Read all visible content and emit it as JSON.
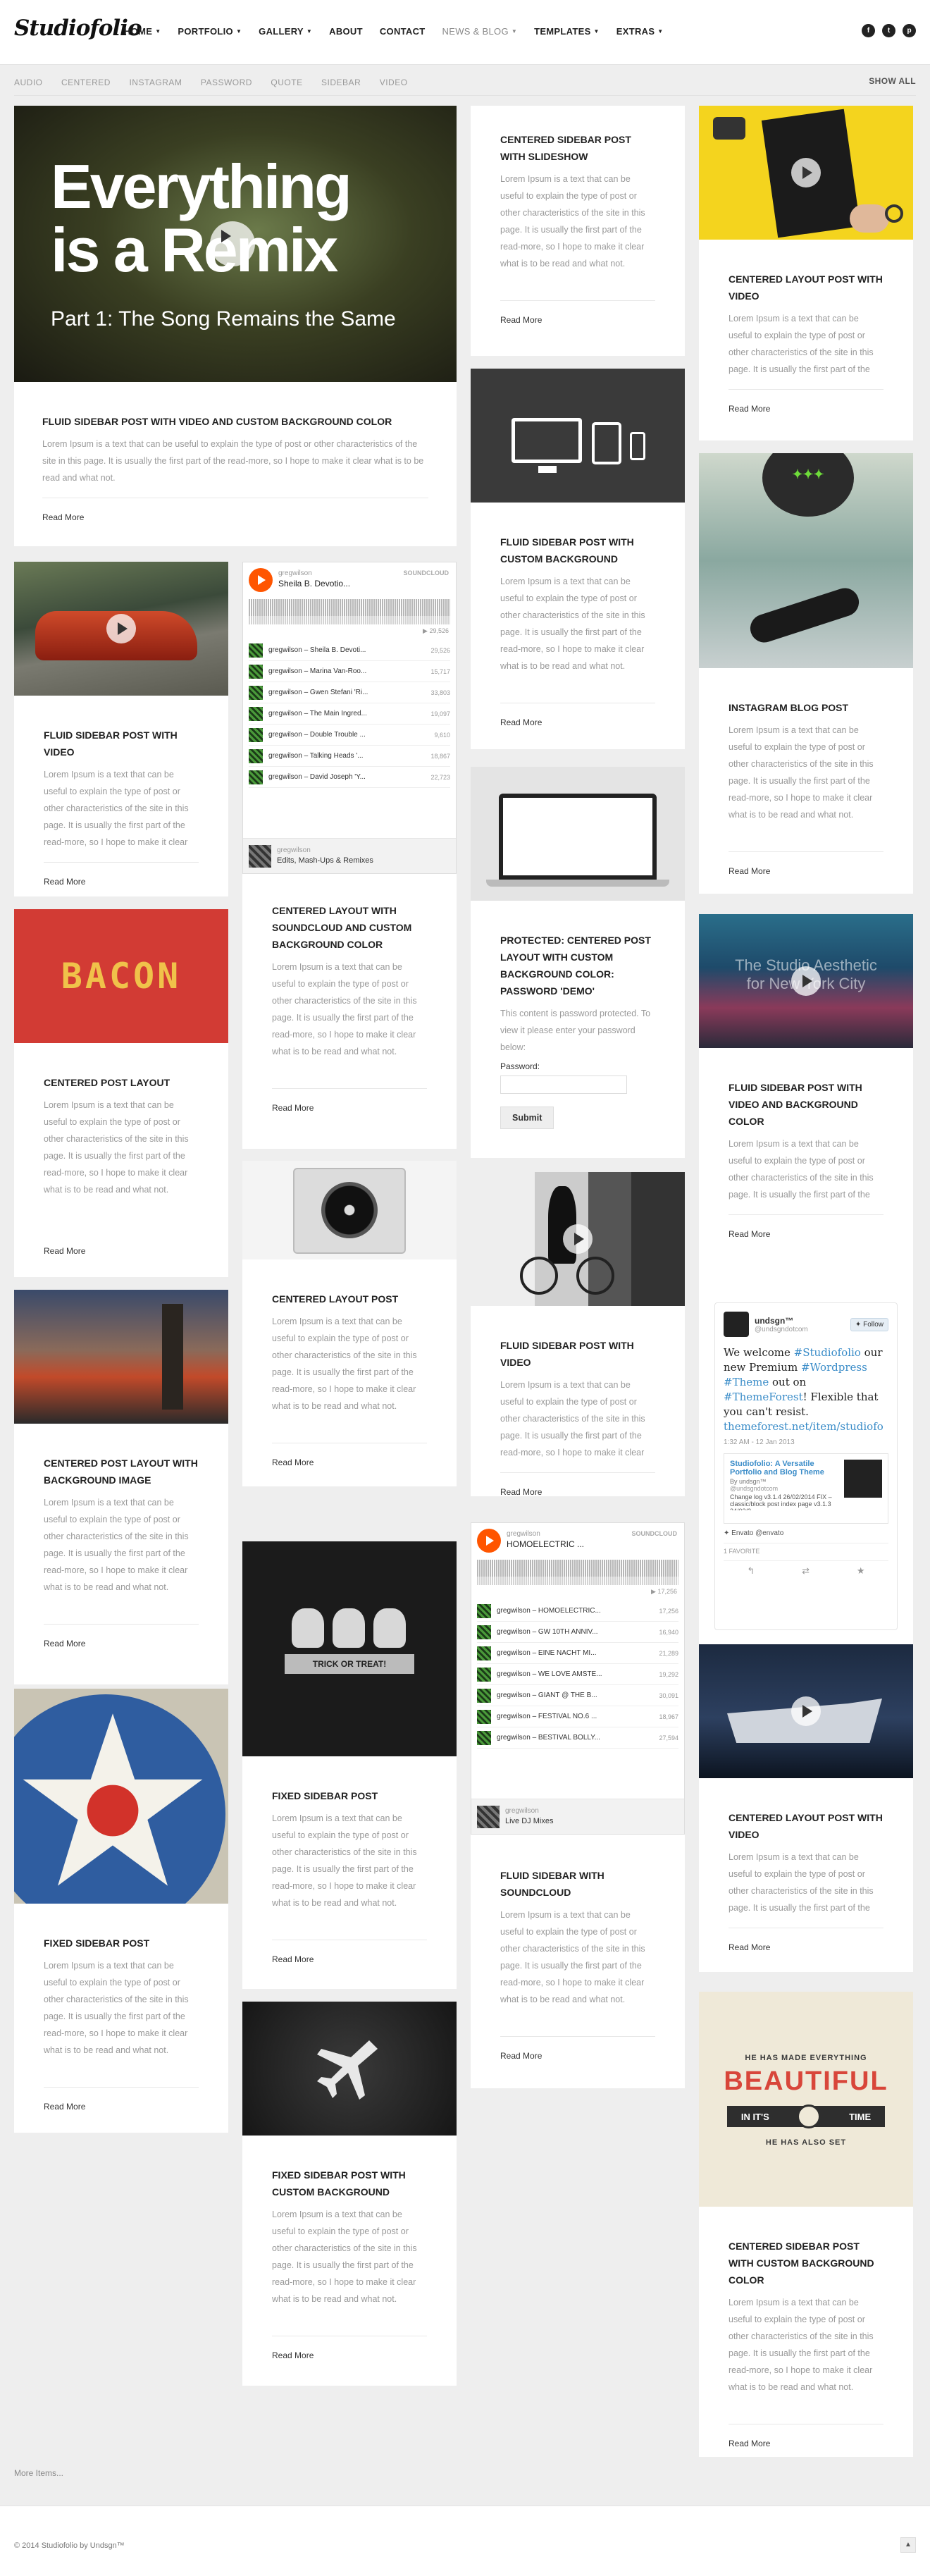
{
  "header": {
    "logo": "Studiofolio",
    "nav": [
      {
        "label": "Home",
        "caret": true
      },
      {
        "label": "Portfolio",
        "caret": true
      },
      {
        "label": "Gallery",
        "caret": true
      },
      {
        "label": "About",
        "caret": false
      },
      {
        "label": "Contact",
        "caret": false
      },
      {
        "label": "News & Blog",
        "caret": true,
        "muted": true
      },
      {
        "label": "Templates",
        "caret": true
      },
      {
        "label": "Extras",
        "caret": true
      }
    ],
    "social_icons": [
      "facebook-icon",
      "twitter-icon",
      "pinterest-icon"
    ]
  },
  "filters": [
    "Audio",
    "Centered",
    "Instagram",
    "Password",
    "Quote",
    "Sidebar",
    "Video"
  ],
  "show_all": "Show All",
  "common": {
    "body": "Lorem Ipsum is a text that can be useful to explain the type of post or other characteristics of the site in this page. It is usually the first part of the read-more, so I hope to make it clear what is to be read and what not.",
    "read_more": "Read More"
  },
  "hero": {
    "line1": "Everything",
    "line2": "is a Remix",
    "subtitle": "Part 1: The Song Remains the Same"
  },
  "posts": {
    "p1": "Fluid sidebar post with video and custom background color",
    "p2": "Fluid sidebar post with video",
    "p3": "Centered post layout",
    "p4": "Centered post layout with background image",
    "p5": "Fixed sidebar post",
    "p6": "Centered layout with soundcloud and custom background color",
    "p7": "Centered layout post",
    "p8": "Fixed sidebar post",
    "p9": "Fixed sidebar post with custom background",
    "p10": "Centered sidebar post with slideshow",
    "p11": "Fluid sidebar post with custom background",
    "p12": "Protected: Centered post layout with custom background color: password 'demo'",
    "p13": "Fluid sidebar post with video",
    "p14": "Fluid sidebar with soundcloud",
    "p15": "Centered layout post with video",
    "p16": "Instagram blog post",
    "p17": "Fluid sidebar post with video and background color",
    "p18": "Centered layout post with video",
    "p19": "Centered sidebar post with custom background color"
  },
  "bacon": "BACON",
  "trick": "TRICK OR TREAT!",
  "studio_img": {
    "line1": "The Studio Aesthetic",
    "line2": "for New York City"
  },
  "quote_img": {
    "top": "HE HAS MADE EVERYTHING",
    "big": "BEAUTIFUL",
    "in": "IN IT'S",
    "time": "TIME",
    "bottom": "HE HAS ALSO SET"
  },
  "protected": {
    "msg": "This content is password protected. To view it please enter your password below:",
    "label": "Password:",
    "submit": "Submit"
  },
  "sc1": {
    "user": "gregwilson",
    "track": "Sheila B. Devotio...",
    "brand": "SOUNDCLOUD",
    "time": "1:45",
    "total": "29,526",
    "rows": [
      {
        "t": "gregwilson – Sheila B. Devoti...",
        "c": "29,526"
      },
      {
        "t": "gregwilson – Marina Van-Roo...",
        "c": "15,717"
      },
      {
        "t": "gregwilson – Gwen Stefani 'Ri...",
        "c": "33,803"
      },
      {
        "t": "gregwilson – The Main Ingred...",
        "c": "19,097"
      },
      {
        "t": "gregwilson – Double Trouble ...",
        "c": "9,610"
      },
      {
        "t": "gregwilson – Talking Heads '...",
        "c": "18,867"
      },
      {
        "t": "gregwilson – David Joseph 'Y...",
        "c": "22,723"
      }
    ],
    "foot_user": "gregwilson",
    "foot_name": "Edits, Mash-Ups & Remixes"
  },
  "sc2": {
    "user": "gregwilson",
    "track": "HOMOELECTRIC ...",
    "brand": "SOUNDCLOUD",
    "time": "2:01:55",
    "total": "17,256",
    "rows": [
      {
        "t": "gregwilson – HOMOELECTRIC...",
        "c": "17,256"
      },
      {
        "t": "gregwilson – GW 10TH ANNIV...",
        "c": "16,940"
      },
      {
        "t": "gregwilson – EINE NACHT MI...",
        "c": "21,289"
      },
      {
        "t": "gregwilson – WE LOVE AMSTE...",
        "c": "19,292"
      },
      {
        "t": "gregwilson – GIANT @ THE B...",
        "c": "30,091"
      },
      {
        "t": "gregwilson – FESTIVAL NO.6 ...",
        "c": "18,967"
      },
      {
        "t": "gregwilson – BESTIVAL BOLLY...",
        "c": "27,594"
      }
    ],
    "foot_user": "gregwilson",
    "foot_name": "Live DJ Mixes"
  },
  "tweet": {
    "name": "undsgn™",
    "handle": "@undsgndotcom",
    "follow": "Follow",
    "text1": "We welcome",
    "tag1": "#Studiofolio",
    "text2": "our new Premium",
    "tag2": "#Wordpress",
    "tag3": "#Theme",
    "text3": "out on",
    "tag4": "#ThemeForest",
    "text4": "! Flexible that you can't resist.",
    "url": "themeforest.net/item/studiofo",
    "date": "1:32 AM - 12 Jan 2013",
    "card_title": "Studiofolio: A Versatile Portfolio and Blog Theme",
    "card_by": "By undsgn™",
    "card_handle": "@undsgndotcom",
    "card_text": "Change log v3.1.4 26/02/2014 FIX – classic/block post index page v3.1.3 24/02/2...",
    "envato": "Envato @envato",
    "fav": "1 FAVORITE"
  },
  "more_items": "More Items...",
  "footer": {
    "copyright": "© 2014 Studiofolio by Undsgn™"
  }
}
